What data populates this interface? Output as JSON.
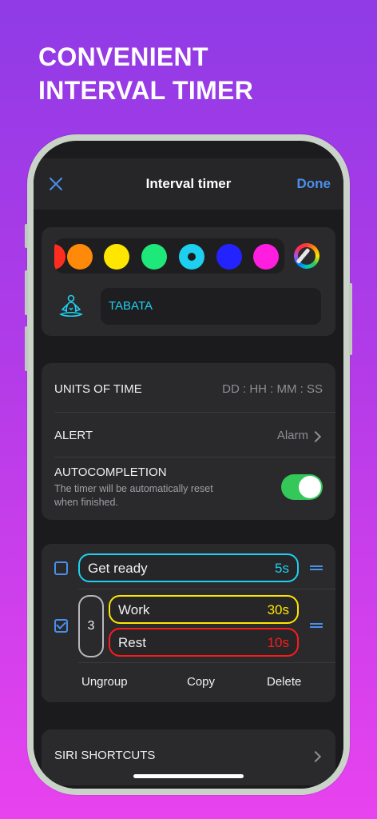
{
  "headline": [
    "CONVENIENT",
    "INTERVAL TIMER"
  ],
  "navbar": {
    "close_icon": "close-icon",
    "title": "Interval timer",
    "done_label": "Done"
  },
  "colors": {
    "swatches": [
      "#ff2d20",
      "#ff8a0a",
      "#ffe600",
      "#1ee87a",
      "#1ed0f0",
      "#2323ff",
      "#ff1edf"
    ],
    "selected": "#1ed0f0",
    "picker_icon": "color-picker-icon"
  },
  "timer": {
    "name_icon": "meditation-icon",
    "name_value": "TABATA"
  },
  "settings": {
    "units_label": "UNITS OF TIME",
    "units_value": "DD : HH : MM : SS",
    "alert_label": "ALERT",
    "alert_value": "Alarm",
    "autocompletion_label": "AUTOCOMPLETION",
    "autocompletion_sub": "The timer will be automatically reset when finished.",
    "autocompletion_on": true
  },
  "intervals": {
    "get_ready": {
      "label": "Get ready",
      "value": "5s",
      "color": "#1ed0f0",
      "checked": false
    },
    "group": {
      "rounds": "3",
      "checked": true,
      "work": {
        "label": "Work",
        "value": "30s",
        "color": "#ffe600"
      },
      "rest": {
        "label": "Rest",
        "value": "10s",
        "color": "#ff1a1a"
      }
    },
    "actions": {
      "ungroup": "Ungroup",
      "copy": "Copy",
      "delete": "Delete"
    }
  },
  "siri": {
    "label": "SIRI SHORTCUTS"
  }
}
